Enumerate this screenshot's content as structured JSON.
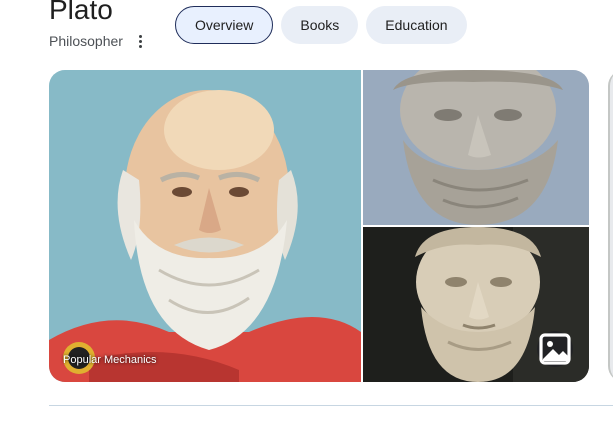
{
  "entity": {
    "name": "Plato",
    "type": "Philosopher"
  },
  "tabs": [
    {
      "label": "Overview",
      "active": true
    },
    {
      "label": "Books",
      "active": false
    },
    {
      "label": "Education",
      "active": false
    }
  ],
  "images": {
    "credit": "Popular Mechanics"
  },
  "icons": {
    "more": "more-vert-icon",
    "gallery": "image-gallery-icon"
  },
  "colors": {
    "active_tab_bg": "#e8f0fe",
    "active_tab_border": "#1f2d5a",
    "tab_bg": "#e9eef6"
  }
}
